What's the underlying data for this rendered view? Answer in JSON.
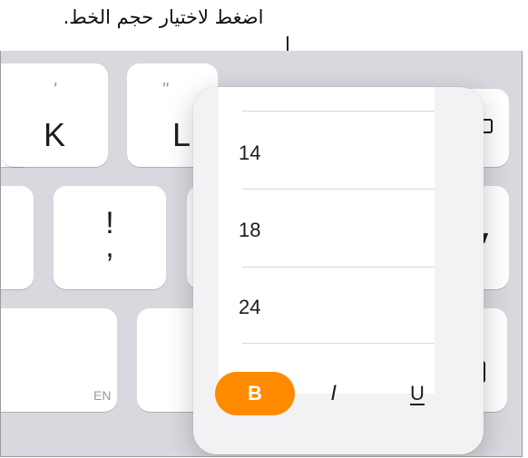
{
  "callout": {
    "text": "اضغط لاختيار حجم الخط."
  },
  "keyboard": {
    "k_key": {
      "label": "K",
      "alt": "'"
    },
    "l_key": {
      "label": "L",
      "alt": "\""
    },
    "punct_key": {
      "label": "!",
      "alt": ","
    },
    "lang_key": {
      "label": "EN"
    }
  },
  "font_size_picker": {
    "sizes": [
      "14",
      "18",
      "24"
    ],
    "selected": "18"
  },
  "format_bar": {
    "bold_label": "B",
    "italic_label": "I",
    "underline_label": "U",
    "bold_active": true,
    "accent_color": "#ff8a00"
  }
}
